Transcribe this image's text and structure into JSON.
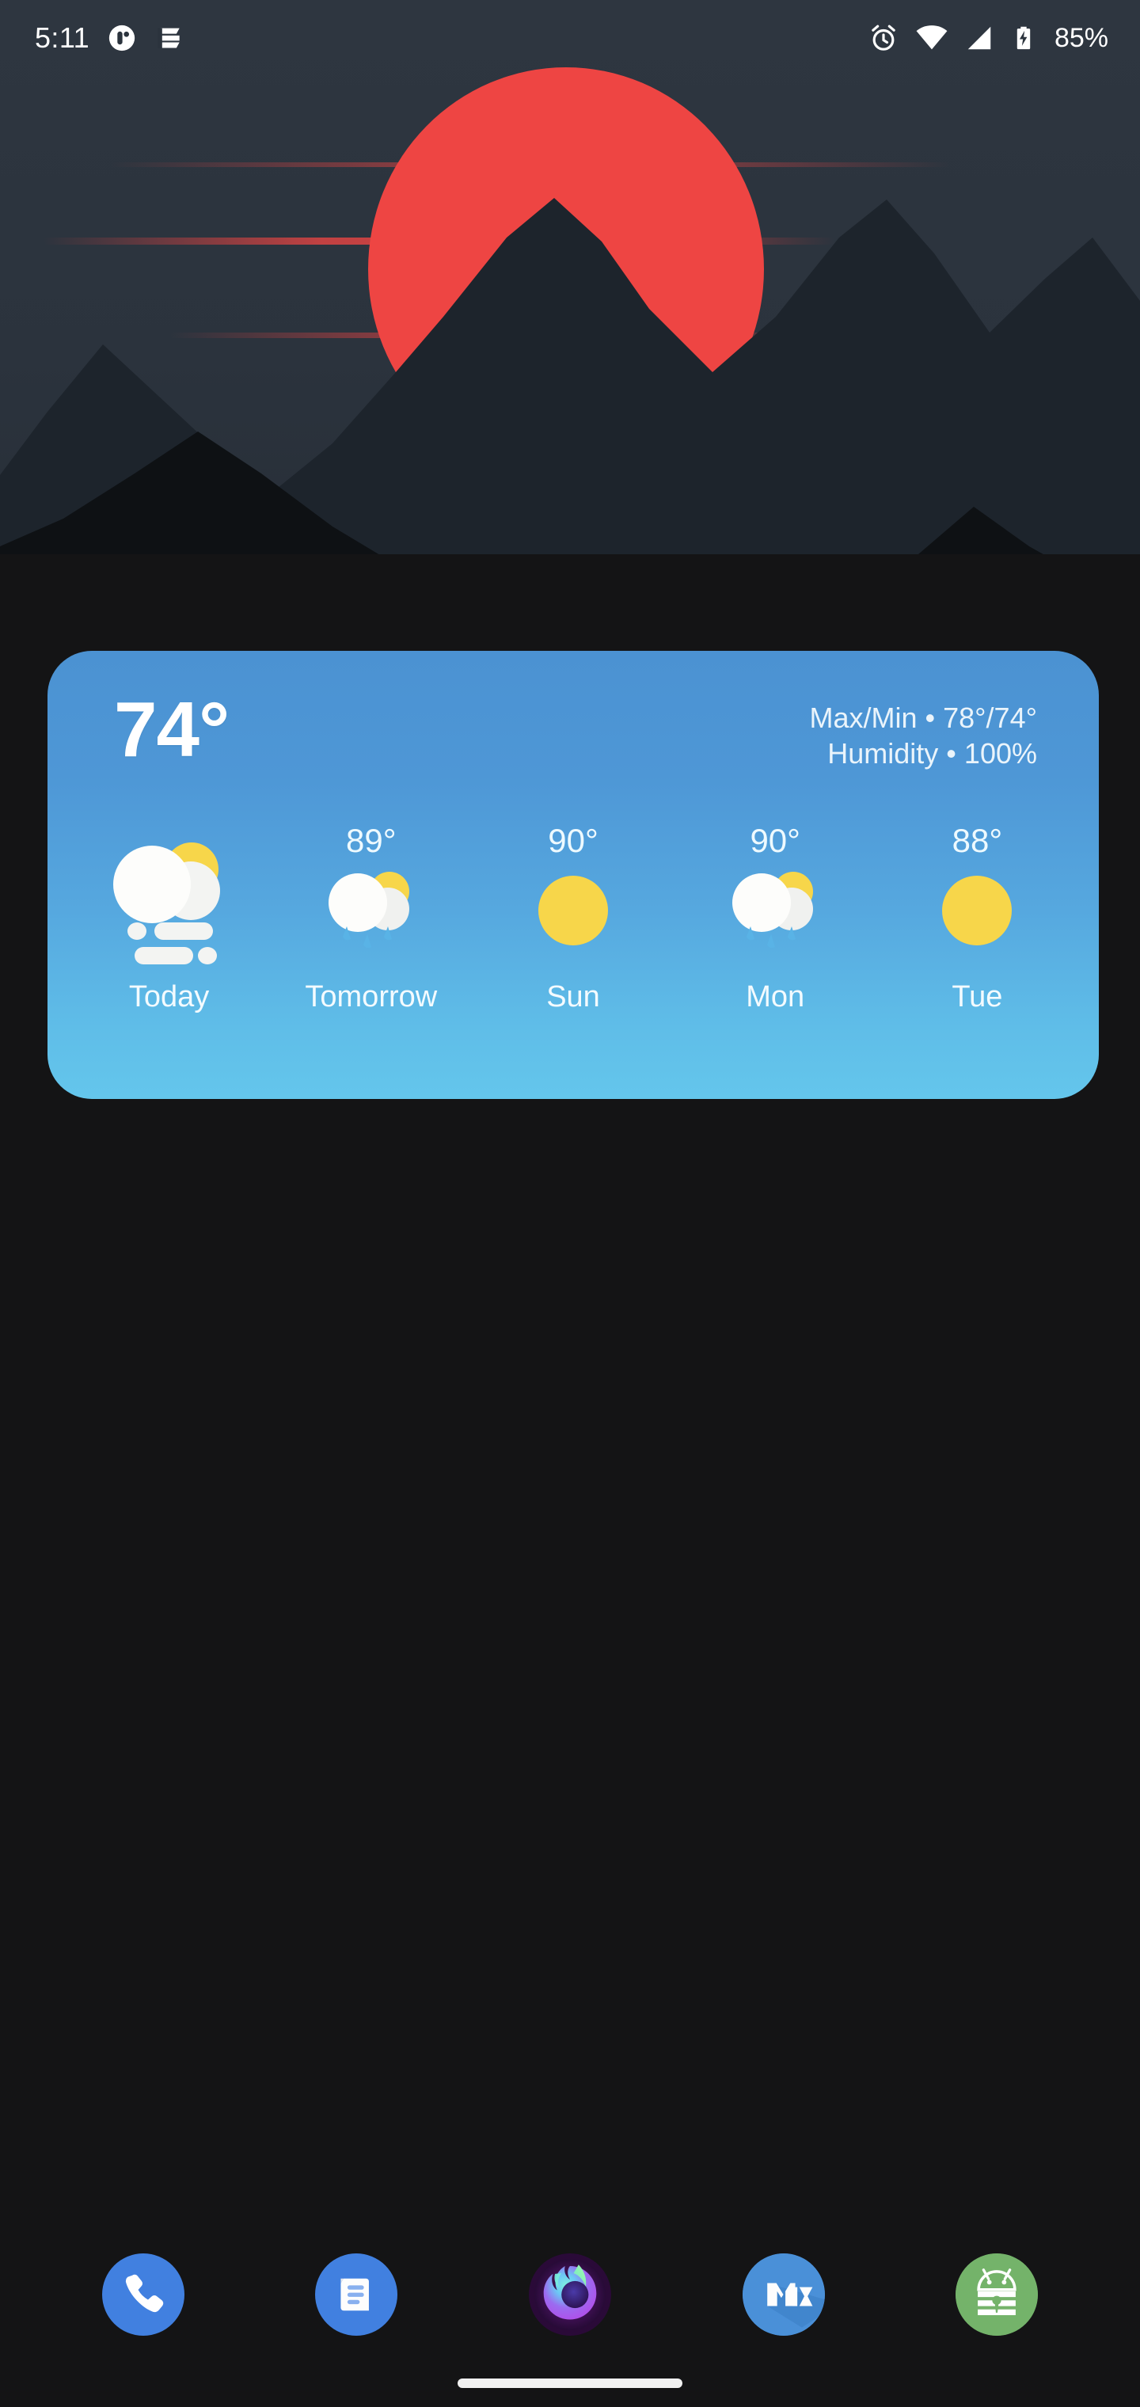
{
  "status_bar": {
    "clock": "5:11",
    "battery_percent": "85%",
    "left_icons": [
      "notification-dot-icon",
      "notification-lines-icon"
    ],
    "right_icons": [
      "alarm-icon",
      "wifi-icon",
      "cellular-signal-icon",
      "battery-charging-icon"
    ],
    "background_color": "#2b333d",
    "foreground_color": "#ffffff"
  },
  "wallpaper": {
    "name": "red-sun-mountains-wallpaper",
    "sky_color": "#2b333d",
    "sun_color": "#ee4543",
    "mountain_color": "#1d242c",
    "foreground_mountain_color": "#0e1114",
    "lava_color": "#ee4543"
  },
  "weather_widget": {
    "name": "weather-forecast-widget",
    "current_temp": "74°",
    "max_min": "Max/Min • 78°/74°",
    "humidity": "Humidity • 100%",
    "gradient_top": "#4b92d2",
    "gradient_bottom": "#64c6ec",
    "forecast": [
      {
        "label": "Today",
        "temp": "",
        "icon": "cloudy-sun-fog-icon",
        "condition": "haze"
      },
      {
        "label": "Tomorrow",
        "temp": "89°",
        "icon": "cloudy-sun-rain-icon",
        "condition": "rain"
      },
      {
        "label": "Sun",
        "temp": "90°",
        "icon": "sunny-icon",
        "condition": "clear"
      },
      {
        "label": "Mon",
        "temp": "90°",
        "icon": "cloudy-sun-rain-icon",
        "condition": "rain"
      },
      {
        "label": "Tue",
        "temp": "88°",
        "icon": "sunny-icon",
        "condition": "clear"
      }
    ]
  },
  "dock": {
    "apps": [
      {
        "label": "Phone",
        "icon": "phone-icon",
        "bg": "#4180e0"
      },
      {
        "label": "Messages",
        "icon": "messages-icon",
        "bg": "#4180e0"
      },
      {
        "label": "Firefox",
        "icon": "firefox-icon",
        "bg": "#2a0a38"
      },
      {
        "label": "MiX",
        "icon": "mix-files-icon",
        "bg": "#4a90d8"
      },
      {
        "label": "KeePassDroid",
        "icon": "keepass-droid-icon",
        "bg": "#74b36a"
      }
    ]
  },
  "navigation": {
    "gesture_pill": "home-gesture-pill"
  }
}
